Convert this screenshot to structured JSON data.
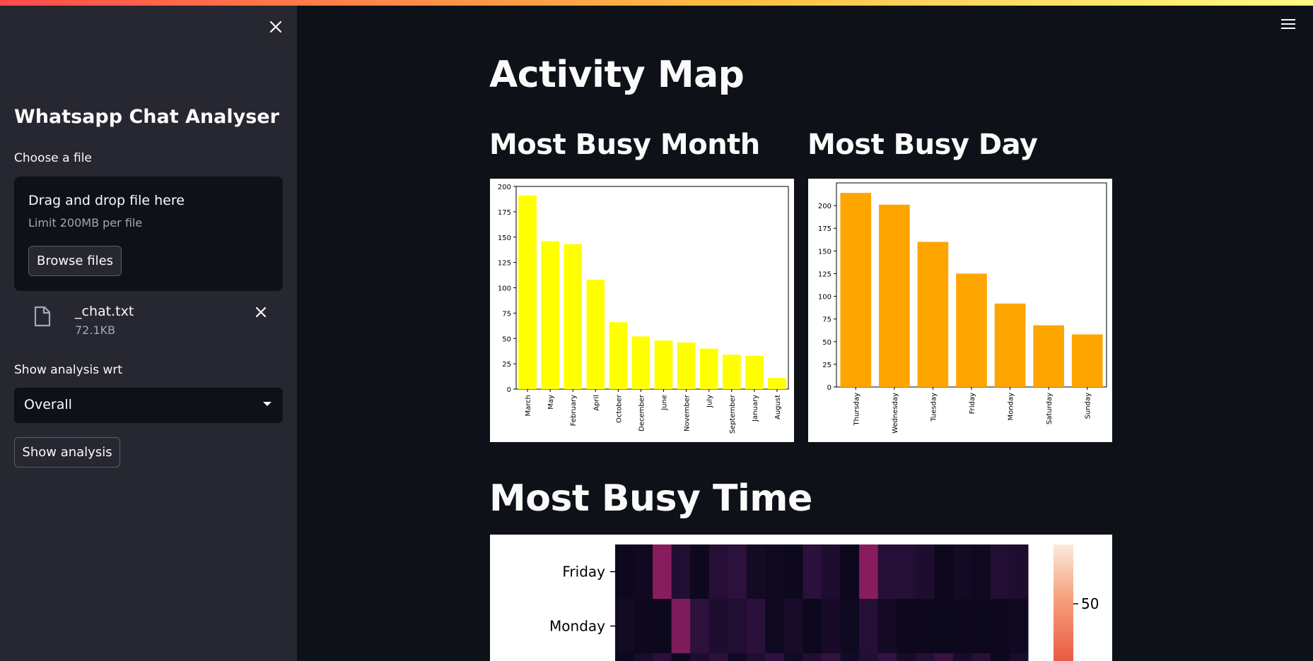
{
  "sidebar": {
    "title": "Whatsapp Chat Analyser",
    "file_label": "Choose a file",
    "dropzone_title": "Drag and drop file here",
    "dropzone_limit": "Limit 200MB per file",
    "browse_label": "Browse files",
    "file": {
      "name": "_chat.txt",
      "size": "72.1KB"
    },
    "analysis_label": "Show analysis wrt",
    "analysis_selected": "Overall",
    "show_button": "Show analysis"
  },
  "main": {
    "title": "Activity Map",
    "month_heading": "Most Busy Month",
    "day_heading": "Most Busy Day",
    "time_heading": "Most Busy Time"
  },
  "colors": {
    "accent_stripe_start": "#ff4b4b",
    "accent_stripe_end": "#fffd80",
    "month_bar": "#ffff00",
    "day_bar": "#ffa500"
  },
  "chart_data": [
    {
      "type": "bar",
      "color": "#ffff00",
      "categories": [
        "March",
        "May",
        "February",
        "April",
        "October",
        "December",
        "June",
        "November",
        "July",
        "September",
        "January",
        "August"
      ],
      "values": [
        191,
        146,
        143,
        108,
        66,
        52,
        48,
        46,
        40,
        34,
        33,
        11
      ],
      "ylim": [
        0,
        200
      ],
      "yticks": [
        0,
        25,
        50,
        75,
        100,
        125,
        150,
        175,
        200
      ],
      "grid": false
    },
    {
      "type": "bar",
      "color": "#ffa500",
      "categories": [
        "Thursday",
        "Wednesday",
        "Tuesday",
        "Friday",
        "Monday",
        "Saturday",
        "Sunday"
      ],
      "values": [
        214,
        201,
        160,
        125,
        92,
        68,
        58
      ],
      "ylim": [
        0,
        225
      ],
      "yticks": [
        0,
        25,
        50,
        75,
        100,
        125,
        150,
        175,
        200
      ],
      "grid": false
    },
    {
      "type": "heatmap",
      "row_labels": [
        "Friday",
        "Monday"
      ],
      "colorbar_ticks": [
        50
      ],
      "values": [
        [
          0,
          2,
          45,
          10,
          0,
          12,
          15,
          3,
          1,
          0,
          14,
          8,
          0,
          45,
          12,
          12,
          8,
          0,
          4,
          1,
          10,
          8
        ],
        [
          3,
          0,
          0,
          42,
          15,
          8,
          10,
          14,
          1,
          6,
          0,
          5,
          1,
          12,
          4,
          0,
          0,
          0,
          0,
          0,
          0,
          2
        ]
      ]
    }
  ]
}
